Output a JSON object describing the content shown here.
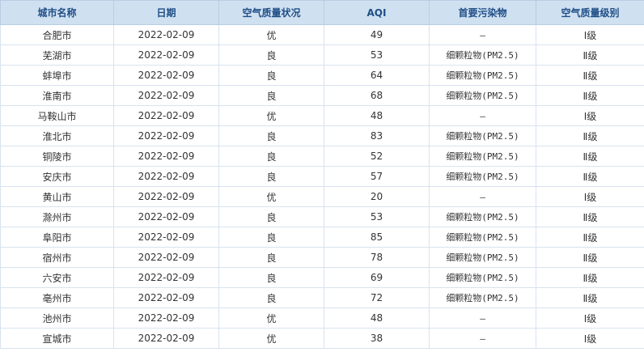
{
  "table": {
    "headers": [
      "城市名称",
      "日期",
      "空气质量状况",
      "AQI",
      "首要污染物",
      "空气质量级别"
    ],
    "rows": [
      [
        "合肥市",
        "2022-02-09",
        "优",
        "49",
        "—",
        "Ⅰ级"
      ],
      [
        "芜湖市",
        "2022-02-09",
        "良",
        "53",
        "细颗粒物(PM2.5)",
        "Ⅱ级"
      ],
      [
        "蚌埠市",
        "2022-02-09",
        "良",
        "64",
        "细颗粒物(PM2.5)",
        "Ⅱ级"
      ],
      [
        "淮南市",
        "2022-02-09",
        "良",
        "68",
        "细颗粒物(PM2.5)",
        "Ⅱ级"
      ],
      [
        "马鞍山市",
        "2022-02-09",
        "优",
        "48",
        "—",
        "Ⅰ级"
      ],
      [
        "淮北市",
        "2022-02-09",
        "良",
        "83",
        "细颗粒物(PM2.5)",
        "Ⅱ级"
      ],
      [
        "铜陵市",
        "2022-02-09",
        "良",
        "52",
        "细颗粒物(PM2.5)",
        "Ⅱ级"
      ],
      [
        "安庆市",
        "2022-02-09",
        "良",
        "57",
        "细颗粒物(PM2.5)",
        "Ⅱ级"
      ],
      [
        "黄山市",
        "2022-02-09",
        "优",
        "20",
        "—",
        "Ⅰ级"
      ],
      [
        "滁州市",
        "2022-02-09",
        "良",
        "53",
        "细颗粒物(PM2.5)",
        "Ⅱ级"
      ],
      [
        "阜阳市",
        "2022-02-09",
        "良",
        "85",
        "细颗粒物(PM2.5)",
        "Ⅱ级"
      ],
      [
        "宿州市",
        "2022-02-09",
        "良",
        "78",
        "细颗粒物(PM2.5)",
        "Ⅱ级"
      ],
      [
        "六安市",
        "2022-02-09",
        "良",
        "69",
        "细颗粒物(PM2.5)",
        "Ⅱ级"
      ],
      [
        "亳州市",
        "2022-02-09",
        "良",
        "72",
        "细颗粒物(PM2.5)",
        "Ⅱ级"
      ],
      [
        "池州市",
        "2022-02-09",
        "优",
        "48",
        "—",
        "Ⅰ级"
      ],
      [
        "宣城市",
        "2022-02-09",
        "优",
        "38",
        "—",
        "Ⅰ级"
      ]
    ]
  },
  "colors": {
    "header_bg": "#cfe0f1",
    "header_text": "#1f4e86",
    "border": "#d7e3ef"
  }
}
